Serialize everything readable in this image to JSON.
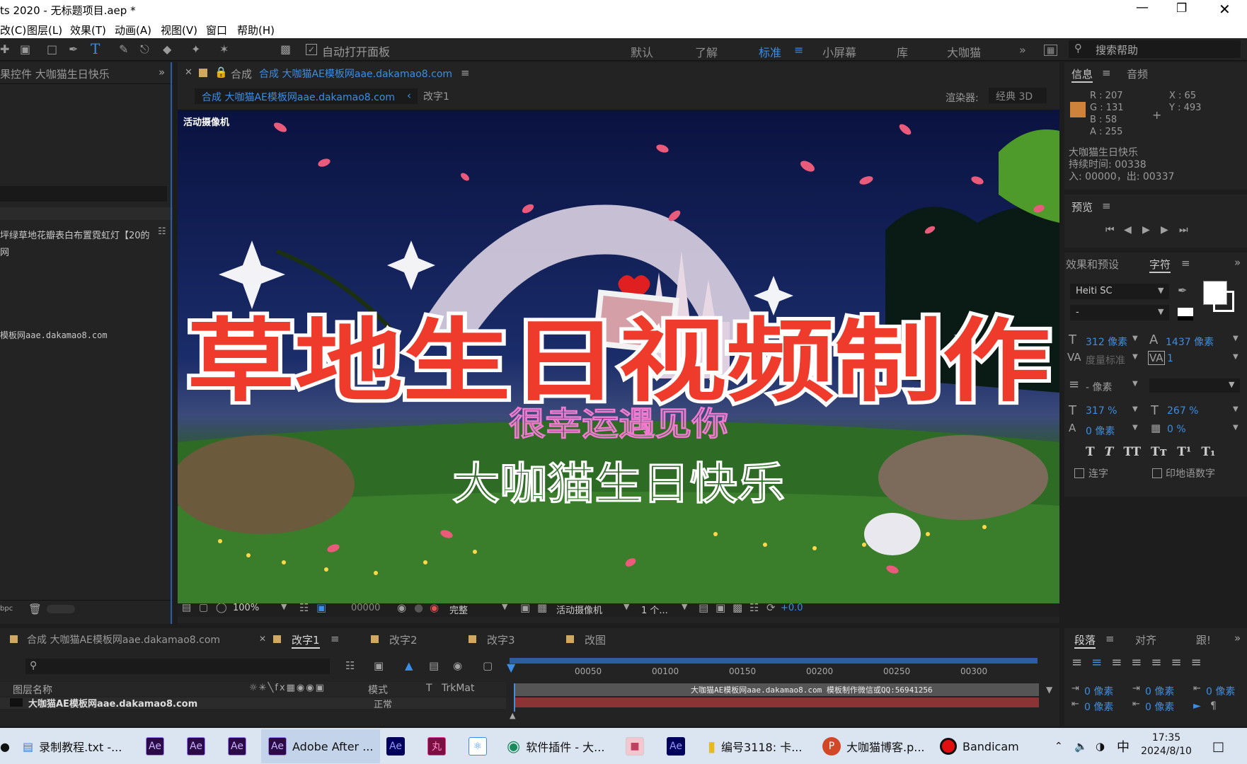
{
  "app": {
    "title": "ts 2020 - 无标题项目.aep *"
  },
  "menu": [
    "改(C)",
    "图层(L)",
    "效果(T)",
    "动画(A)",
    "视图(V)",
    "窗口",
    "帮助(H)"
  ],
  "toolbar": {
    "auto_open_label": "自动打开面板",
    "workspaces": [
      "默认",
      "了解",
      "标准",
      "小屏幕",
      "库",
      "大咖猫"
    ],
    "active_workspace": "标准",
    "search_placeholder": "搜索帮助"
  },
  "left_panel": {
    "title": "果控件 大咖猫生日快乐",
    "item1": "坪绿草地花瓣表白布置霓虹灯【20的",
    "item2": "网",
    "item3": "模板网aae.dakamao8.com",
    "bpc": "bpc"
  },
  "comp_panel": {
    "tab_prefix": "合成",
    "tab_name": "合成 大咖猫AE模板网aae.dakamao8.com",
    "breadcrumb1": "合成 大咖猫AE模板网aae.dakamao8.com",
    "breadcrumb2": "改字1",
    "renderer_label": "渲染器:",
    "renderer_value": "经典 3D",
    "camera_label": "活动摄像机"
  },
  "video": {
    "headline": "草地生日视频制作",
    "line2": "很幸运遇见你",
    "line3": "大咖猫生日快乐"
  },
  "viewer_controls": {
    "zoom": "100%",
    "timecode": "00000",
    "resolution": "完整",
    "camera": "活动摄像机",
    "views": "1 个...",
    "exposure": "+0.0"
  },
  "info_panel": {
    "tab1": "信息",
    "tab2": "音频",
    "r": "R : 207",
    "g": "G : 131",
    "b": "B : 58",
    "a": "A : 255",
    "x": "X : 65",
    "y": "Y : 493",
    "swatch_color": "#cf833a",
    "name": "大咖猫生日快乐",
    "duration": "持续时间: 00338",
    "inout": "入: 00000，出: 00337"
  },
  "preview_panel": {
    "title": "预览"
  },
  "char_panel": {
    "tab1": "效果和预设",
    "tab2": "字符",
    "font": "Heiti SC",
    "style": "-",
    "size": "312 像素",
    "leading": "1437 像素",
    "kern": "度量标准",
    "tracking": "1",
    "stroke": "- 像素",
    "vscale": "317 %",
    "hscale": "267 %",
    "baseline": "0 像素",
    "tsume": "0 %",
    "ligature": "连字",
    "hindi": "印地语数字",
    "styles": [
      "T",
      "T",
      "TT",
      "Tт",
      "T¹",
      "T₁"
    ]
  },
  "para_panel": {
    "tab1": "段落",
    "tab2": "对齐",
    "tab3": "跟!",
    "indent1": "0 像素",
    "indent2": "0 像素",
    "indent3": "0 像素",
    "space1": "0 像素",
    "space2": "0 像素"
  },
  "timeline": {
    "tabs": [
      "合成 大咖猫AE模板网aae.dakamao8.com",
      "改字1",
      "改字2",
      "改字3",
      "改图"
    ],
    "active_tab": "改字1",
    "col_layer": "图层名称",
    "col_mode": "模式",
    "col_t": "T",
    "col_trkmat": "TrkMat",
    "ruler": [
      "00050",
      "00100",
      "00150",
      "00200",
      "00250",
      "00300"
    ],
    "layer_bar_text": "大咖猫AE模板网aae.dakamao8.com  模板制作微信或QQ:56941256",
    "row_name": "大咖猫AE模板网aae.dakamao8.com",
    "row_mode": "正常"
  },
  "taskbar": {
    "items": [
      "录制教程.txt -...",
      "Adobe After ...",
      "软件插件 - 大...",
      "编号3118: 卡...",
      "大咖猫博客.p...",
      "Bandicam"
    ],
    "ime": "中",
    "time": "17:35",
    "date": "2024/8/10"
  }
}
